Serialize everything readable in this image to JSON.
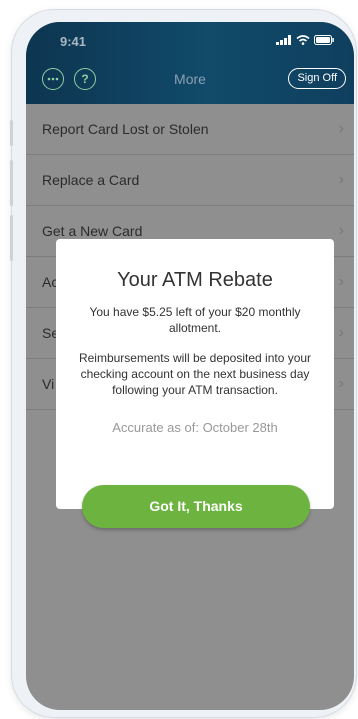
{
  "status_bar": {
    "time": "9:41"
  },
  "header": {
    "title": "More",
    "sign_off_label": "Sign Off",
    "chat_icon": "chat-bubble-icon",
    "help_icon": "help-circle-icon",
    "help_glyph": "?"
  },
  "menu": {
    "items": [
      {
        "label": "Report Card Lost or Stolen"
      },
      {
        "label": "Replace a Card"
      },
      {
        "label": "Get a New Card"
      },
      {
        "label": "Ac"
      },
      {
        "label": "Se"
      },
      {
        "label": "Vi"
      }
    ]
  },
  "modal": {
    "title": "Your ATM Rebate",
    "allotment_text": "You have $5.25 left of your $20 monthly allotment.",
    "reimbursement_text": "Reimbursements will be deposited into your checking account on the next business day following your ATM transaction.",
    "accuracy_text": "Accurate as of: October 28th",
    "button_label": "Got It, Thanks"
  },
  "colors": {
    "header": "#114a6a",
    "accent_green": "#6cb33f",
    "icon_green": "#8fd0a3",
    "overlay": "#8f8f8f"
  }
}
